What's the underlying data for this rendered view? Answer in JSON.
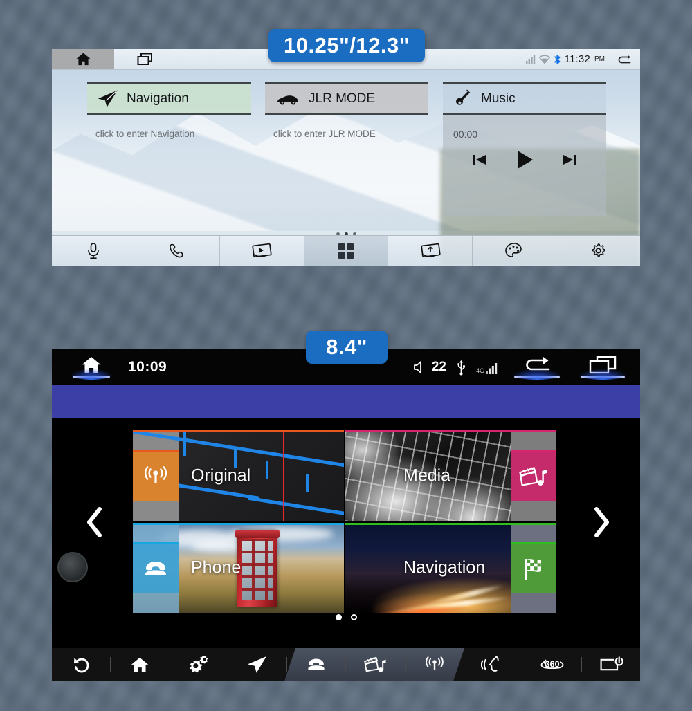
{
  "badges": {
    "top": "10.25\"/12.3\"",
    "bottom": "8.4\"",
    "color": "#1a6dc0"
  },
  "top_unit": {
    "tabs": [
      {
        "name": "home-tab",
        "icon": "home-icon",
        "active": true
      },
      {
        "name": "recents-tab",
        "icon": "windows-icon",
        "active": false
      }
    ],
    "status": {
      "signal_icon": "signal-bars-icon",
      "wifi_icon": "wifi-icon",
      "bluetooth_icon": "bluetooth-icon",
      "time": "11:32",
      "ampm": "PM",
      "back_icon": "back-arrow-icon"
    },
    "widgets": [
      {
        "id": "navigation",
        "icon": "paper-plane-icon",
        "title": "Navigation",
        "hint": "click to enter Navigation",
        "header_color": "#c9e0cb"
      },
      {
        "id": "jlr_mode",
        "icon": "car-icon",
        "title": "JLR MODE",
        "hint": "click to enter JLR MODE",
        "header_color": "#c4c4c6"
      },
      {
        "id": "music",
        "icon": "guitar-icon",
        "title": "Music",
        "time": "00:00",
        "header_color": "#becddc"
      }
    ],
    "music_controls": [
      {
        "name": "previous-track-button",
        "icon": "previous-icon"
      },
      {
        "name": "play-button",
        "icon": "play-icon"
      },
      {
        "name": "next-track-button",
        "icon": "next-icon"
      }
    ],
    "page_dots": {
      "count": 3,
      "active_index": 1
    },
    "dock": [
      {
        "name": "voice-dock-item",
        "icon": "microphone-icon",
        "active": false
      },
      {
        "name": "phone-dock-item",
        "icon": "handset-icon",
        "active": false
      },
      {
        "name": "media-dock-item",
        "icon": "screen-media-icon",
        "active": false
      },
      {
        "name": "apps-dock-item",
        "icon": "app-grid-icon",
        "active": true
      },
      {
        "name": "mirror-dock-item",
        "icon": "screen-mirror-icon",
        "active": false
      },
      {
        "name": "theme-dock-item",
        "icon": "palette-icon",
        "active": false
      },
      {
        "name": "settings-dock-item",
        "icon": "gear-icon",
        "active": false
      }
    ]
  },
  "bottom_unit": {
    "status": {
      "home_icon": "home-icon",
      "time": "10:09",
      "volume_icon": "speaker-icon",
      "volume": "22",
      "usb_icon": "usb-icon",
      "network_label": "4G",
      "network_icon": "signal-bars-icon",
      "back_icon": "back-arrow-icon",
      "recents_icon": "windows-icon"
    },
    "carousel": {
      "prev_icon": "chevron-left-icon",
      "next_icon": "chevron-right-icon",
      "knob": "rotary-knob"
    },
    "tiles": [
      {
        "id": "original",
        "label": "Original",
        "icon": "radio-tower-icon",
        "badge_color": "#d9832e",
        "accent": "#e8581f",
        "badge_side": "left"
      },
      {
        "id": "media",
        "label": "Media",
        "icon": "clapperboard-note-icon",
        "badge_color": "#c52a6b",
        "accent": "#d6246f",
        "badge_side": "right"
      },
      {
        "id": "phone",
        "label": "Phone",
        "icon": "telephone-icon",
        "badge_color": "#2f9fd6",
        "accent": "#17a6e0",
        "badge_side": "left"
      },
      {
        "id": "navigation",
        "label": "Navigation",
        "icon": "checkered-flag-icon",
        "badge_color": "#4f9b3a",
        "accent": "#2fbd1f",
        "badge_side": "right"
      }
    ],
    "page_dots": {
      "count": 2,
      "active_index": 0
    },
    "nav_bar": [
      {
        "name": "back-nav-item",
        "icon": "back-arrow-icon",
        "highlighted": false
      },
      {
        "name": "home-nav-item",
        "icon": "home-icon",
        "highlighted": false
      },
      {
        "name": "settings-nav-item",
        "icon": "gears-icon",
        "highlighted": false
      },
      {
        "name": "navigation-nav-item",
        "icon": "paper-plane-icon",
        "highlighted": true
      },
      {
        "name": "phone-nav-item",
        "icon": "telephone-icon",
        "highlighted": true
      },
      {
        "name": "media-nav-item",
        "icon": "clapperboard-note-icon",
        "highlighted": true
      },
      {
        "name": "radio-nav-item",
        "icon": "radio-tower-icon",
        "highlighted": true
      },
      {
        "name": "voice-nav-item",
        "icon": "voice-command-icon",
        "highlighted": false
      },
      {
        "name": "camera360-nav-item",
        "icon": "360-camera-icon",
        "highlighted": false
      },
      {
        "name": "screen-off-nav-item",
        "icon": "screen-power-icon",
        "highlighted": false
      }
    ]
  }
}
